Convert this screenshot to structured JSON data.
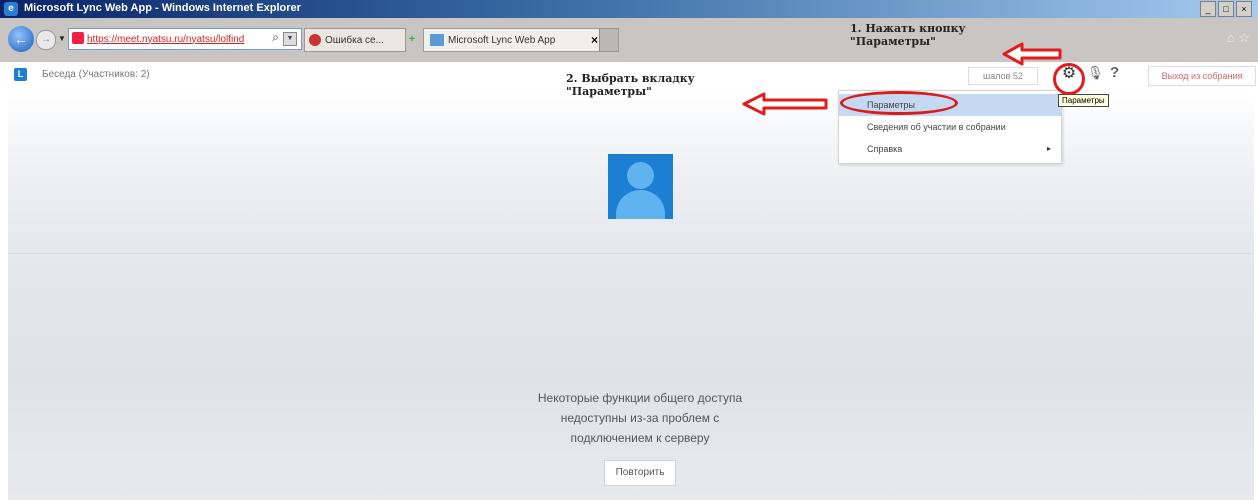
{
  "window": {
    "title": "Microsoft Lync Web App - Windows Internet Explorer",
    "buttons": [
      "_",
      "□",
      "×"
    ]
  },
  "browser": {
    "address_url": "https://meet.nyatsu.ru/nyatsu/lolfind",
    "tab_error_label": "Ошибка се...",
    "tab_active_label": "Microsoft Lync Web App",
    "new_tab_glyph": "+",
    "home_icons": "⌂ ☆"
  },
  "app": {
    "logo_glyph": "L",
    "conversation_title": "Беседа (Участников: 2)",
    "timer": "шалов 52",
    "help_glyph": "?",
    "leave_button": "Выход из собрания",
    "tooltip": "Параметры"
  },
  "menu": {
    "items": [
      {
        "label": "Параметры",
        "has_submenu": false
      },
      {
        "label": "Сведения об участии в собрании",
        "has_submenu": false
      },
      {
        "label": "Справка",
        "has_submenu": true
      }
    ],
    "submenu_arrow": "▸"
  },
  "main": {
    "message_lines": [
      "Некоторые функции общего доступа",
      "недоступны из-за проблем с",
      "подключением к серверу"
    ],
    "retry_button": "Повторить"
  },
  "annotations": {
    "step1_line1": "1. Нажать кнопку",
    "step1_line2": "\"Параметры\"",
    "step2_line1": "2. Выбрать вкладку",
    "step2_line2": "\"Параметры\""
  },
  "colors": {
    "annotation_red": "#e41b1b",
    "lync_blue": "#1c7fd1",
    "menu_highlight": "#c5daf2"
  }
}
